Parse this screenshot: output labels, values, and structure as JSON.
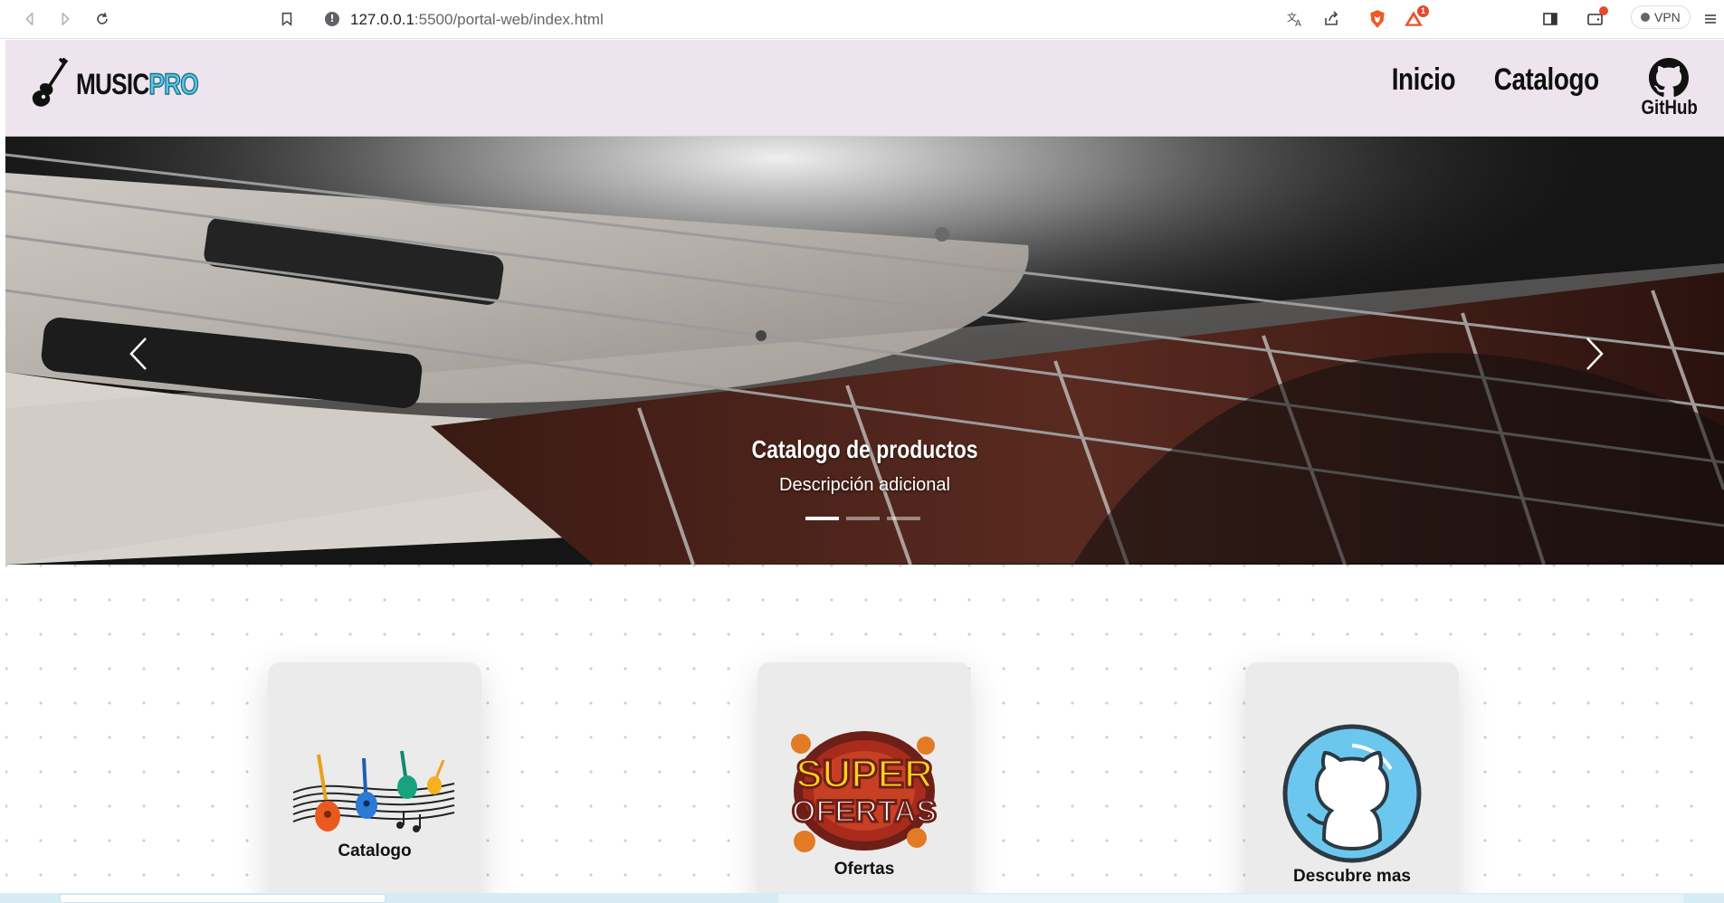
{
  "browser": {
    "url_host": "127.0.0.1",
    "url_path": ":5500/portal-web/index.html",
    "notification_count": "1",
    "vpn_label": "VPN"
  },
  "header": {
    "logo_part1": "MUSIC",
    "logo_part2": "PRO",
    "nav": {
      "home": "Inicio",
      "catalog": "Catalogo",
      "github": "GitHub"
    }
  },
  "carousel": {
    "title": "Catalogo de productos",
    "description": "Descripción adicional",
    "slide_count": 3,
    "active_index": 0
  },
  "cards": [
    {
      "title": "Catalogo",
      "image_text": ""
    },
    {
      "title": "Ofertas",
      "image_text_top": "SUPER",
      "image_text_bottom": "OFERTAS"
    },
    {
      "title": "Descubre mas"
    }
  ],
  "colors": {
    "header_bg": "#ede4ee",
    "accent_pro": "#5ac8e6",
    "card_bg": "#ebebeb"
  }
}
